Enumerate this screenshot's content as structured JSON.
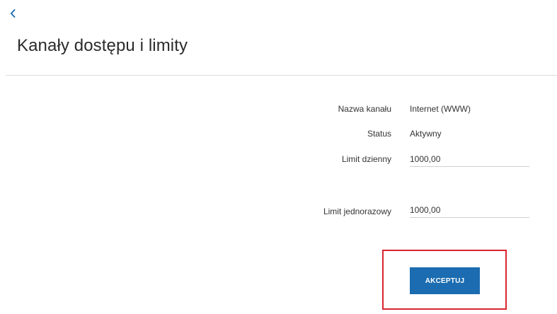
{
  "header": {
    "back_icon": "chevron-left-icon",
    "title": "Kanały dostępu i limity"
  },
  "details": {
    "channel_label": "Nazwa kanału",
    "channel_value": "Internet (WWW)",
    "status_label": "Status",
    "status_value": "Aktywny",
    "daily_limit_label": "Limit dzienny",
    "daily_limit_value": "1000,00",
    "single_limit_label": "Limit jednorazowy",
    "single_limit_value": "1000,00"
  },
  "actions": {
    "accept_label": "AKCEPTUJ"
  },
  "colors": {
    "accent": "#1b6cb0",
    "highlight": "#d9252f"
  }
}
